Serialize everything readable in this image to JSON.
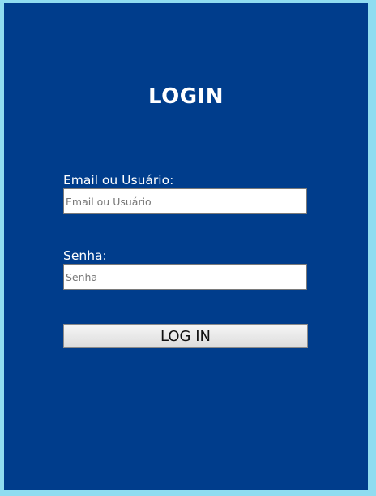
{
  "login": {
    "title": "LOGIN",
    "email_label": "Email ou Usuário:",
    "email_placeholder": "Email ou Usuário",
    "email_value": "",
    "password_label": "Senha:",
    "password_placeholder": "Senha",
    "password_value": "",
    "submit_label": "LOG IN"
  },
  "colors": {
    "page_background": "#8fdcf0",
    "panel_background": "#003d8c",
    "text": "#ffffff"
  }
}
